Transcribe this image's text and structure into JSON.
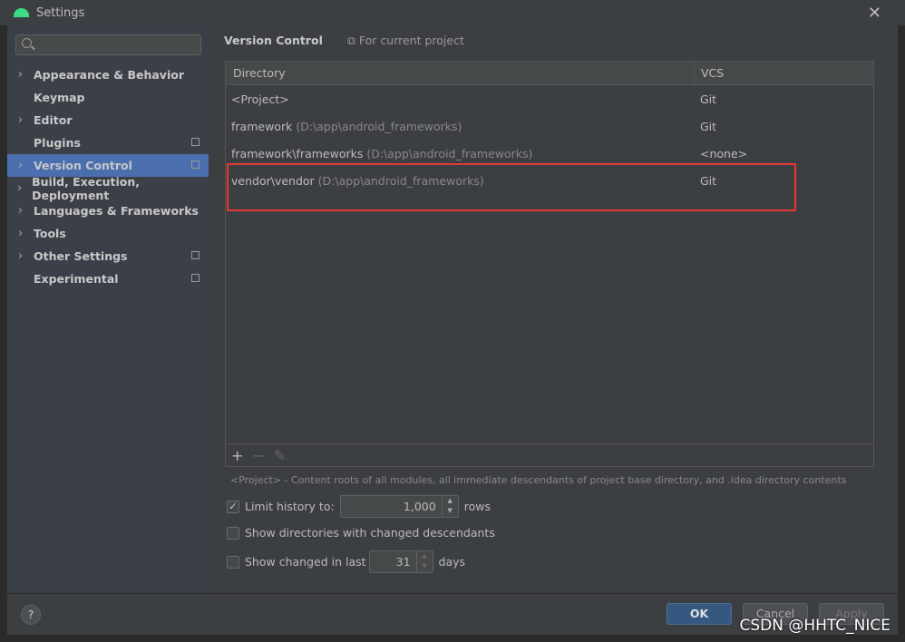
{
  "window": {
    "title": "Settings"
  },
  "sidebar": {
    "items": [
      {
        "label": "Appearance & Behavior",
        "expandable": true,
        "project": false
      },
      {
        "label": "Keymap",
        "expandable": false,
        "project": false
      },
      {
        "label": "Editor",
        "expandable": true,
        "project": false
      },
      {
        "label": "Plugins",
        "expandable": false,
        "project": true
      },
      {
        "label": "Version Control",
        "expandable": true,
        "project": true,
        "selected": true
      },
      {
        "label": "Build, Execution, Deployment",
        "expandable": true,
        "project": false
      },
      {
        "label": "Languages & Frameworks",
        "expandable": true,
        "project": false
      },
      {
        "label": "Tools",
        "expandable": true,
        "project": false
      },
      {
        "label": "Other Settings",
        "expandable": true,
        "project": true
      },
      {
        "label": "Experimental",
        "expandable": false,
        "project": true
      }
    ]
  },
  "main": {
    "title": "Version Control",
    "scope": "For current project",
    "table": {
      "headers": [
        "Directory",
        "VCS"
      ],
      "rows": [
        {
          "name": "<Project>",
          "path": "",
          "vcs": "Git"
        },
        {
          "name": "framework",
          "path": "(D:\\app\\android_frameworks)",
          "vcs": "Git"
        },
        {
          "name": "framework\\frameworks",
          "path": "(D:\\app\\android_frameworks)",
          "vcs": "<none>"
        },
        {
          "name": "vendor\\vendor",
          "path": "(D:\\app\\android_frameworks)",
          "vcs": "Git"
        }
      ]
    },
    "note": "<Project> - Content roots of all modules, all immediate descendants of project base directory, and .idea directory contents",
    "limit_history": {
      "checked": true,
      "label": "Limit history to:",
      "value": "1,000",
      "unit": "rows"
    },
    "show_dirs": {
      "checked": false,
      "label": "Show directories with changed descendants"
    },
    "show_changed": {
      "checked": false,
      "label": "Show changed in last",
      "value": "31",
      "unit": "days"
    }
  },
  "footer": {
    "help": "?",
    "ok": "OK",
    "cancel": "Cancel",
    "apply": "Apply"
  },
  "watermark": "CSDN @HHTC_NICE",
  "colors": {
    "selection": "#4b6eaf",
    "highlight_box": "#e53935",
    "ok_button": "#365880"
  }
}
